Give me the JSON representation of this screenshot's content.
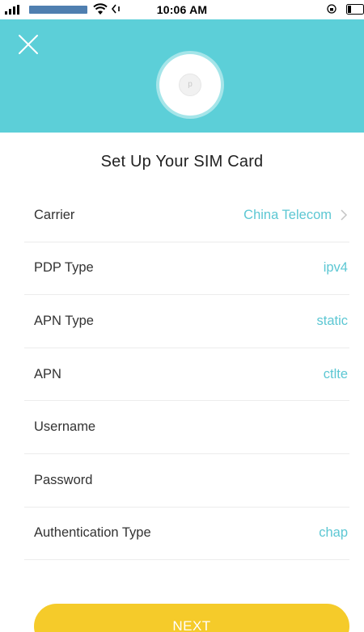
{
  "status_bar": {
    "time": "10:06 AM"
  },
  "header": {
    "background_color": "#5ccfd8",
    "close_icon": "close-icon",
    "device_logo": "p"
  },
  "title": "Set Up Your SIM Card",
  "form": {
    "rows": [
      {
        "label": "Carrier",
        "value": "China Telecom",
        "has_chevron": true
      },
      {
        "label": "PDP Type",
        "value": "ipv4"
      },
      {
        "label": "APN Type",
        "value": "static"
      },
      {
        "label": "APN",
        "value": "ctlte"
      },
      {
        "label": "Username",
        "value": ""
      },
      {
        "label": "Password",
        "value": ""
      },
      {
        "label": "Authentication Type",
        "value": "chap"
      }
    ]
  },
  "next_button": {
    "label": "NEXT",
    "color": "#f5cb2a"
  },
  "colors": {
    "accent": "#5cc7d3",
    "divider": "#ececec"
  }
}
